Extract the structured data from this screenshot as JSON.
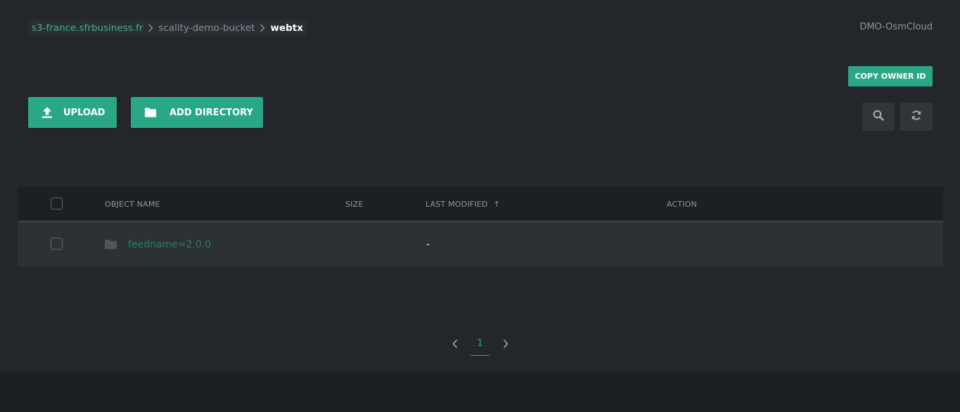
{
  "breadcrumb": {
    "root": "s3-france.sfrbusiness.fr",
    "bucket": "scality-demo-bucket",
    "current": "webtx"
  },
  "account": {
    "name": "DMO-OsmCloud"
  },
  "actions": {
    "copy_owner_id": "COPY OWNER ID",
    "upload": "UPLOAD",
    "add_directory": "ADD DIRECTORY"
  },
  "icons": {
    "upload": "upload-icon",
    "folder": "folder-icon",
    "search": "search-icon",
    "refresh": "refresh-icon",
    "chevron_right": "chevron-right-icon",
    "chevron_left": "chevron-left-icon",
    "sort_asc": "arrow-up-icon"
  },
  "table": {
    "columns": {
      "name": "OBJECT NAME",
      "size": "SIZE",
      "last_modified": "LAST MODIFIED",
      "action": "ACTION"
    },
    "sort_indicator": "↑",
    "rows": [
      {
        "name": "feedname=2.0.0",
        "size": "",
        "last_modified": "-",
        "action": ""
      }
    ]
  },
  "pagination": {
    "current_page": "1"
  },
  "colors": {
    "accent": "#2aa885",
    "background": "#23272b",
    "header_bg": "#1c2023",
    "row_bg": "#2c3135"
  }
}
